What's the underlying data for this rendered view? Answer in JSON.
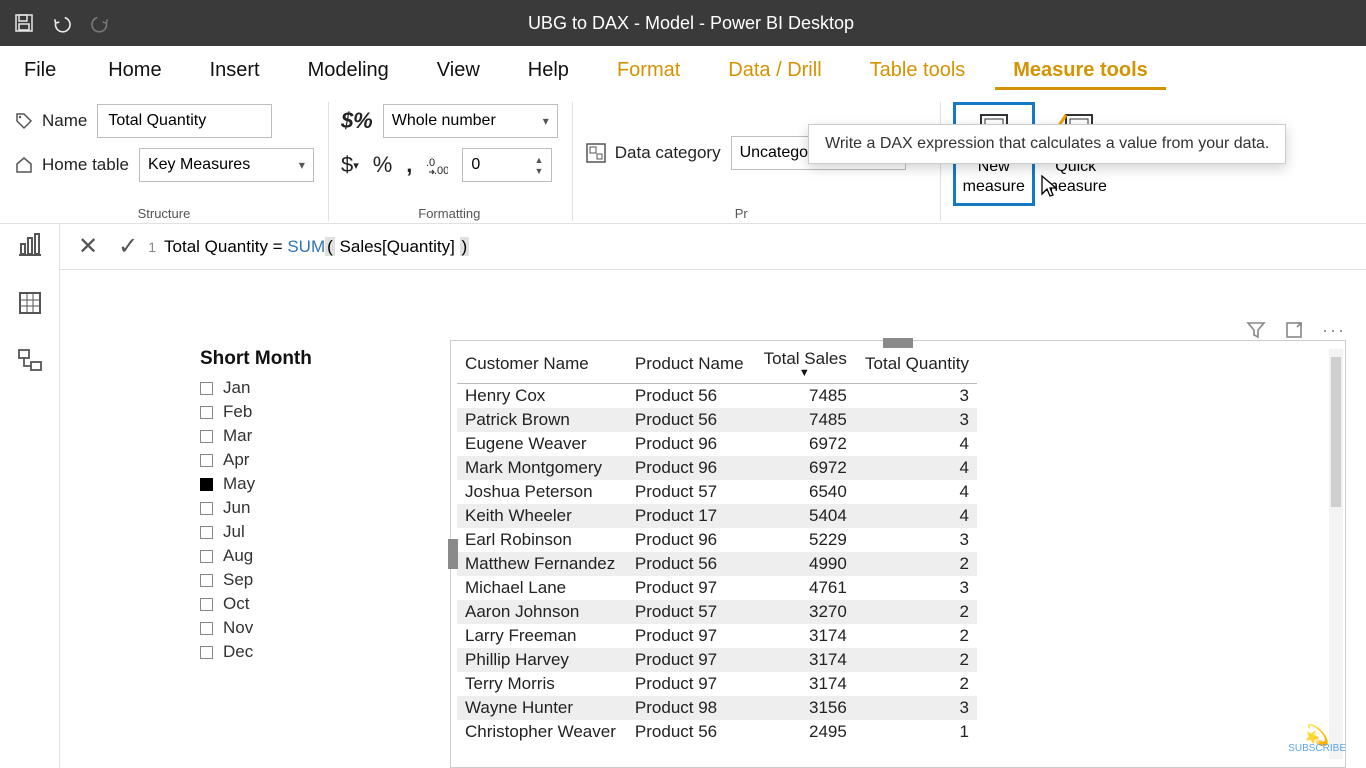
{
  "window": {
    "title": "UBG to DAX - Model - Power BI Desktop"
  },
  "tabs": {
    "file": "File",
    "items": [
      "Home",
      "Insert",
      "Modeling",
      "View",
      "Help"
    ],
    "context": [
      "Format",
      "Data / Drill",
      "Table tools",
      "Measure tools"
    ],
    "active": "Measure tools"
  },
  "ribbon": {
    "structure": {
      "caption": "Structure",
      "name_label": "Name",
      "name_value": "Total Quantity",
      "home_label": "Home table",
      "home_value": "Key Measures"
    },
    "formatting": {
      "caption": "Formatting",
      "format_value": "Whole number",
      "decimals": "0"
    },
    "properties": {
      "caption": "Properties",
      "datacat_label": "Data category",
      "datacat_value": "Uncategorized"
    },
    "calc": {
      "new_measure": "New measure",
      "quick_measure": "Quick measure"
    }
  },
  "tooltip": "Write a DAX expression that calculates a value from your data.",
  "formula": {
    "line": "1",
    "pre": "Total Quantity = ",
    "fn": "SUM",
    "open": "(",
    "arg": " Sales[Quantity] ",
    "close": ")"
  },
  "slicer": {
    "title": "Short Month",
    "items": [
      "Jan",
      "Feb",
      "Mar",
      "Apr",
      "May",
      "Jun",
      "Jul",
      "Aug",
      "Sep",
      "Oct",
      "Nov",
      "Dec"
    ],
    "selected": "May"
  },
  "table": {
    "columns": [
      "Customer Name",
      "Product Name",
      "Total Sales",
      "Total Quantity"
    ],
    "sort_col": "Total Sales",
    "rows": [
      {
        "customer": "Henry Cox",
        "product": "Product 56",
        "sales": 7485,
        "qty": 3
      },
      {
        "customer": "Patrick Brown",
        "product": "Product 56",
        "sales": 7485,
        "qty": 3
      },
      {
        "customer": "Eugene Weaver",
        "product": "Product 96",
        "sales": 6972,
        "qty": 4
      },
      {
        "customer": "Mark Montgomery",
        "product": "Product 96",
        "sales": 6972,
        "qty": 4
      },
      {
        "customer": "Joshua Peterson",
        "product": "Product 57",
        "sales": 6540,
        "qty": 4
      },
      {
        "customer": "Keith Wheeler",
        "product": "Product 17",
        "sales": 5404,
        "qty": 4
      },
      {
        "customer": "Earl Robinson",
        "product": "Product 96",
        "sales": 5229,
        "qty": 3
      },
      {
        "customer": "Matthew Fernandez",
        "product": "Product 56",
        "sales": 4990,
        "qty": 2
      },
      {
        "customer": "Michael Lane",
        "product": "Product 97",
        "sales": 4761,
        "qty": 3
      },
      {
        "customer": "Aaron Johnson",
        "product": "Product 57",
        "sales": 3270,
        "qty": 2
      },
      {
        "customer": "Larry Freeman",
        "product": "Product 97",
        "sales": 3174,
        "qty": 2
      },
      {
        "customer": "Phillip Harvey",
        "product": "Product 97",
        "sales": 3174,
        "qty": 2
      },
      {
        "customer": "Terry Morris",
        "product": "Product 97",
        "sales": 3174,
        "qty": 2
      },
      {
        "customer": "Wayne Hunter",
        "product": "Product 98",
        "sales": 3156,
        "qty": 3
      },
      {
        "customer": "Christopher Weaver",
        "product": "Product 56",
        "sales": 2495,
        "qty": 1
      }
    ]
  },
  "subscribe": "SUBSCRIBE"
}
